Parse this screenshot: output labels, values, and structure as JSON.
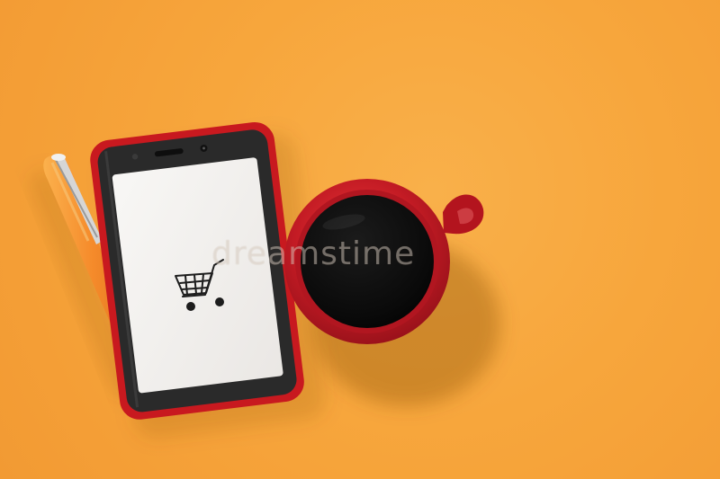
{
  "scene": {
    "background_color": "#f7a63c",
    "objects": [
      {
        "name": "orange-pen",
        "color": "#f7892d"
      },
      {
        "name": "smartphone",
        "case_color": "#c8191f",
        "screen_color": "#f2f0ee"
      },
      {
        "name": "shopping-cart-icon",
        "color": "#1d1d1d"
      },
      {
        "name": "coffee-mug",
        "color": "#c41b24",
        "coffee_color": "#090909"
      }
    ]
  },
  "watermark": {
    "text": "dreamstime"
  }
}
